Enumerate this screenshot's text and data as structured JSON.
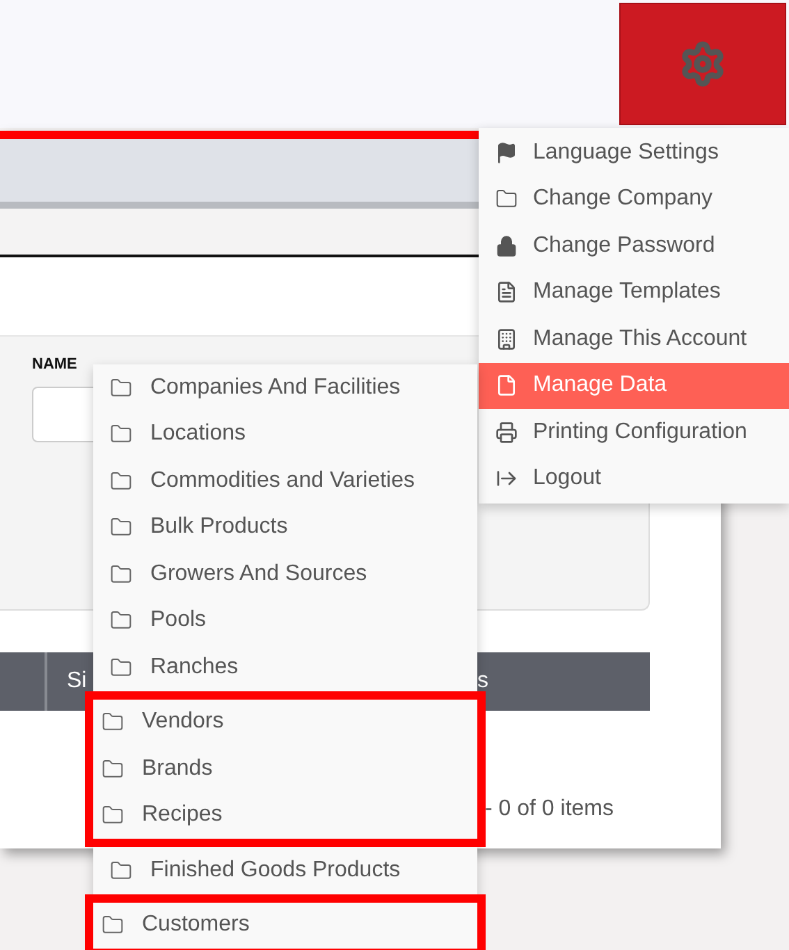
{
  "settings_menu": [
    {
      "label": "Language Settings",
      "kind": "flag",
      "selected": false
    },
    {
      "label": "Change Company",
      "kind": "folder",
      "selected": false
    },
    {
      "label": "Change Password",
      "kind": "lock",
      "selected": false
    },
    {
      "label": "Manage Templates",
      "kind": "template",
      "selected": false
    },
    {
      "label": "Manage This Account",
      "kind": "building",
      "selected": false
    },
    {
      "label": "Manage Data",
      "kind": "file",
      "selected": true
    },
    {
      "label": "Printing Configuration",
      "kind": "printer",
      "selected": false
    },
    {
      "label": "Logout",
      "kind": "logout",
      "selected": false
    }
  ],
  "data_menu": [
    {
      "label": "Companies And Facilities",
      "highlighted": false
    },
    {
      "label": "Locations",
      "highlighted": false
    },
    {
      "label": "Commodities and Varieties",
      "highlighted": false
    },
    {
      "label": "Bulk Products",
      "highlighted": false
    },
    {
      "label": "Growers And Sources",
      "highlighted": false
    },
    {
      "label": "Pools",
      "highlighted": false
    },
    {
      "label": "Ranches",
      "highlighted": false
    },
    {
      "label": "Vendors",
      "highlighted": true
    },
    {
      "label": "Brands",
      "highlighted": true
    },
    {
      "label": "Recipes",
      "highlighted": true
    },
    {
      "label": "Finished Goods Products",
      "highlighted": false
    },
    {
      "label": "Customers",
      "highlighted": true
    }
  ],
  "filter": {
    "label": "NAME"
  },
  "table": {
    "columns": [
      {},
      {
        "label": "Si"
      },
      {
        "label": "s"
      }
    ]
  },
  "pager": {
    "text": "- 0 of 0 items"
  }
}
